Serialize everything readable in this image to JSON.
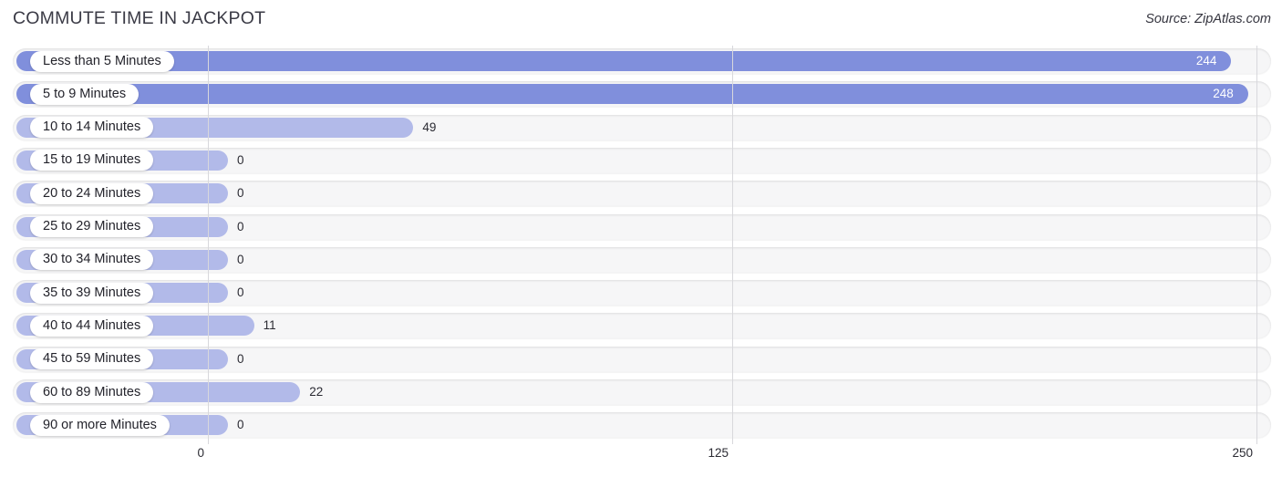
{
  "header": {
    "title": "COMMUTE TIME IN JACKPOT",
    "source": "Source: ZipAtlas.com"
  },
  "chart_data": {
    "type": "bar",
    "orientation": "horizontal",
    "title": "COMMUTE TIME IN JACKPOT",
    "subtitle": "Source: ZipAtlas.com",
    "xlabel": "",
    "ylabel": "",
    "xlim": [
      0,
      250
    ],
    "grid": true,
    "legend": false,
    "ticks": [
      "0",
      "125",
      "250"
    ],
    "tick_values": [
      0,
      125,
      250
    ],
    "categories": [
      "Less than 5 Minutes",
      "5 to 9 Minutes",
      "10 to 14 Minutes",
      "15 to 19 Minutes",
      "20 to 24 Minutes",
      "25 to 29 Minutes",
      "30 to 34 Minutes",
      "35 to 39 Minutes",
      "40 to 44 Minutes",
      "45 to 59 Minutes",
      "60 to 89 Minutes",
      "90 or more Minutes"
    ],
    "values": [
      244,
      248,
      49,
      0,
      0,
      0,
      0,
      0,
      11,
      0,
      22,
      0
    ],
    "value_labels": [
      "244",
      "248",
      "49",
      "0",
      "0",
      "0",
      "0",
      "0",
      "11",
      "0",
      "22",
      "0"
    ],
    "colors": {
      "bar_primary": "#808fdc",
      "bar_secondary": "#b2bae9",
      "track": "#f6f6f7",
      "gridline": "#d8d8dc",
      "label_text": "#23232b",
      "value_text_inside": "#ffffff",
      "value_text_outside": "#2b2b33"
    }
  }
}
